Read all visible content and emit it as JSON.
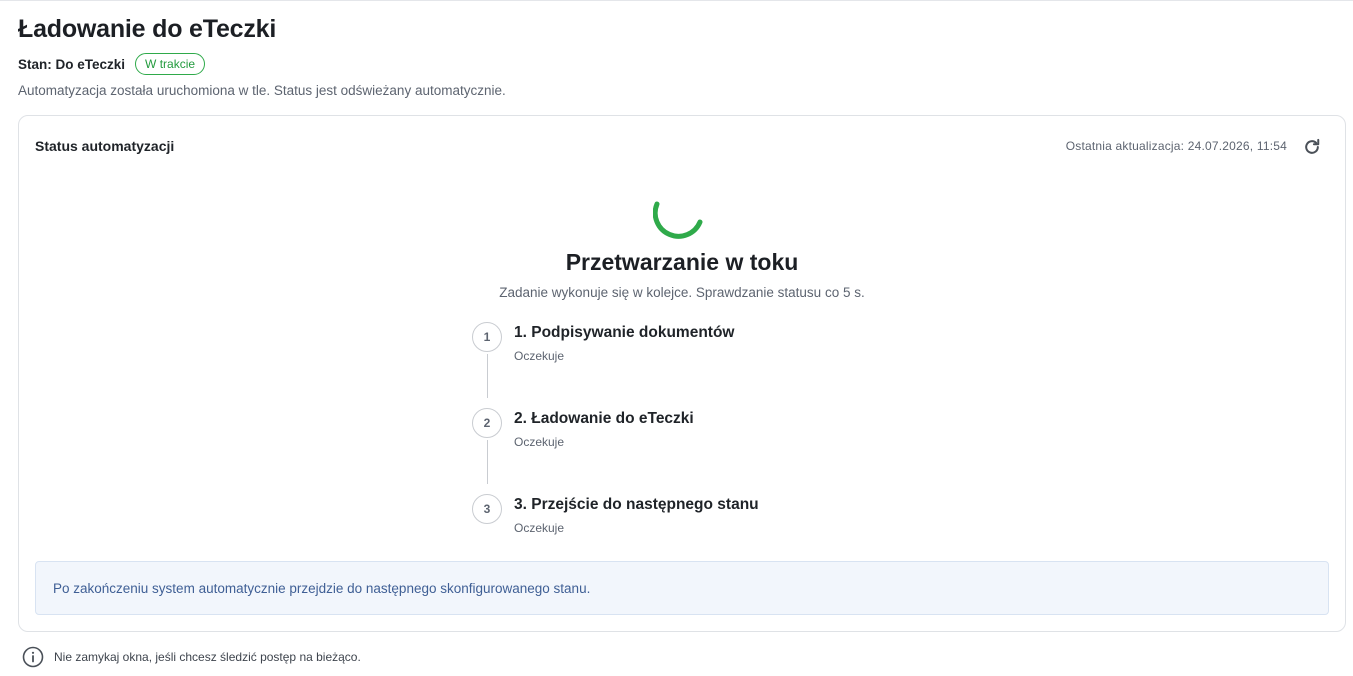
{
  "page": {
    "title": "Ładowanie do eTeczki",
    "state_label": "Stan: Do eTeczki",
    "state_badge": "W trakcie",
    "subtitle": "Automatyzacja została uruchomiona w tle. Status jest odświeżany automatycznie."
  },
  "colors": {
    "accent_green": "#2faa4a",
    "info_text": "#3f5f95",
    "info_bg": "#f2f6fc"
  },
  "card": {
    "title": "Status automatyzacji",
    "last_update": "Ostatnia aktualizacja: 24.07.2026, 11:54",
    "refresh_icon": "refresh-icon",
    "processing_title": "Przetwarzanie w toku",
    "processing_subtitle": "Zadanie wykonuje się w kolejce. Sprawdzanie statusu co 5 s.",
    "steps": [
      {
        "number": "1",
        "title": "1. Podpisywanie dokumentów",
        "status": "Oczekuje"
      },
      {
        "number": "2",
        "title": "2. Ładowanie do eTeczki",
        "status": "Oczekuje"
      },
      {
        "number": "3",
        "title": "3. Przejście do następnego stanu",
        "status": "Oczekuje"
      }
    ],
    "info_message": "Po zakończeniu system automatycznie przejdzie do następnego skonfigurowanego stanu."
  },
  "footer": {
    "icon": "info-icon",
    "note": "Nie zamykaj okna, jeśli chcesz śledzić postęp na bieżąco."
  }
}
